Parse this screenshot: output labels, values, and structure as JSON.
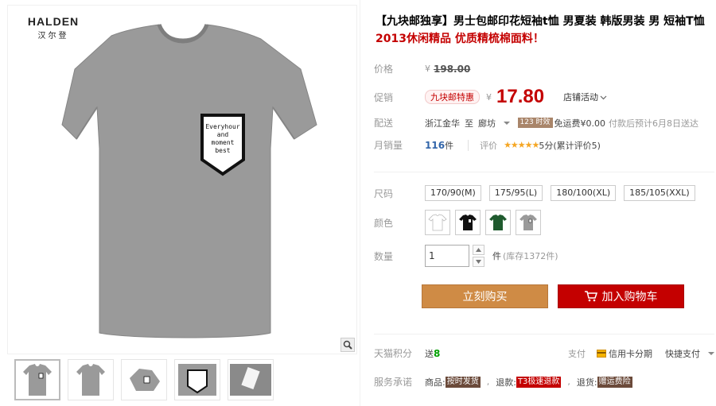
{
  "brand": {
    "name_en": "HALDEN",
    "name_cn": "汉尔登"
  },
  "product": {
    "title": "【九块邮独享】男士包邮印花短袖t恤 男夏装 韩版男装 男 短袖T恤",
    "subtitle": "2013休闲精品 优质精梳棉面料！",
    "print_text": "Everyhour and moment best"
  },
  "price": {
    "label": "价格",
    "currency": "¥",
    "original": "198.00",
    "promo_label": "促销",
    "promo_tag": "九块邮特惠",
    "current": "17.80",
    "store_activity": "店铺活动"
  },
  "shipping": {
    "label": "配送",
    "from": "浙江金华",
    "to_word": "至",
    "to": "廊坊",
    "time_badge": "123 时效",
    "fee": "免运费¥0.00",
    "note": "付款后预计6月8日送达"
  },
  "sales": {
    "label": "月销量",
    "count": "116",
    "unit": "件",
    "rating_label": "评价",
    "stars": "★★★★★",
    "rating_text": "5分(累计评价5)"
  },
  "sizes": {
    "label": "尺码",
    "options": [
      "170/90(M)",
      "175/95(L)",
      "180/100(XL)",
      "185/105(XXL)"
    ]
  },
  "colors": {
    "label": "颜色",
    "swatches": [
      "#ffffff",
      "#111111",
      "#1f5a2e",
      "#9a9a9a"
    ]
  },
  "quantity": {
    "label": "数量",
    "value": "1",
    "unit": "件",
    "stock": "(库存1372件)"
  },
  "buttons": {
    "buy": "立刻购买",
    "cart": "加入购物车"
  },
  "points": {
    "label": "天猫积分",
    "send": "送",
    "value": "8",
    "pay_label": "支付",
    "card": "信用卡分期",
    "quick": "快捷支付"
  },
  "service": {
    "label": "服务承诺",
    "goods": "商品:",
    "goods_tag": "按时发货",
    "refund": "退款:",
    "refund_tag": "T3极速退款",
    "return": "退货:",
    "return_tag": "赠运费险"
  },
  "colors_theme": {
    "accent_red": "#c40000",
    "buy_orange": "#cf8b45"
  }
}
